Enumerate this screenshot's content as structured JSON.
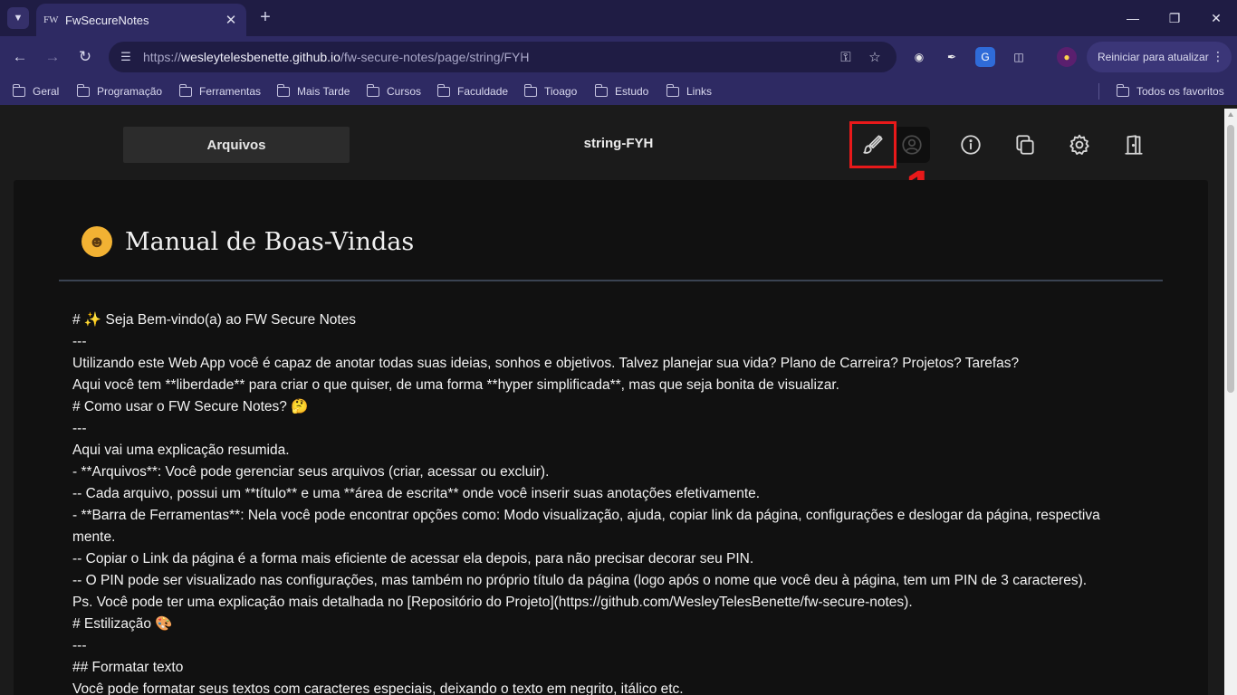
{
  "browser": {
    "tab": {
      "favicon_text": "FW",
      "title": "FwSecureNotes"
    },
    "url": {
      "scheme": "https://",
      "host": "wesleytelesbenette.github.io",
      "path": "/fw-secure-notes/page/string/FYH"
    },
    "update_label": "Reiniciar para atualizar",
    "bookmarks": [
      "Geral",
      "Programação",
      "Ferramentas",
      "Mais Tarde",
      "Cursos",
      "Faculdade",
      "Tioago",
      "Estudo",
      "Links"
    ],
    "all_bookmarks": "Todos os favoritos"
  },
  "app": {
    "files_button": "Arquivos",
    "page_name": "string-FYH",
    "annotation": "1",
    "document": {
      "title": "Manual de Boas-Vindas",
      "lines": [
        "# ✨ Seja Bem-vindo(a) ao FW Secure Notes",
        "---",
        "Utilizando este Web App você é capaz de anotar todas suas ideias, sonhos e objetivos. Talvez planejar sua vida? Plano de Carreira? Projetos? Tarefas?",
        "Aqui você tem **liberdade** para criar o que quiser, de uma forma **hyper simplificada**, mas que seja bonita de visualizar.",
        "# Como usar o FW Secure Notes? 🤔",
        "---",
        "Aqui vai uma explicação resumida.",
        "- **Arquivos**: Você pode gerenciar seus arquivos (criar, acessar ou excluir).",
        "-- Cada arquivo, possui um **título** e uma **área de escrita** onde você inserir suas anotações efetivamente.",
        "- **Barra de Ferramentas**: Nela você pode encontrar opções como: Modo visualização, ajuda, copiar link da página, configurações e deslogar da página, respectiva",
        "mente.",
        "-- Copiar o Link da página é a forma mais eficiente de acessar ela depois, para não precisar decorar seu PIN.",
        "-- O PIN pode ser visualizado nas configurações, mas também no próprio título da página (logo após o nome que você deu à página, tem um PIN de 3 caracteres).",
        "Ps. Você pode ter uma explicação mais detalhada no [Repositório do Projeto](https://github.com/WesleyTelesBenette/fw-secure-notes).",
        "# Estilização 🎨",
        "---",
        "## Formatar texto",
        "Você pode formatar seus textos com caracteres especiais, deixando o texto em negrito, itálico etc."
      ]
    }
  },
  "colors": {
    "highlight": "#e8191a",
    "chrome": "#2e2a63",
    "tabstrip": "#1f1c44"
  }
}
